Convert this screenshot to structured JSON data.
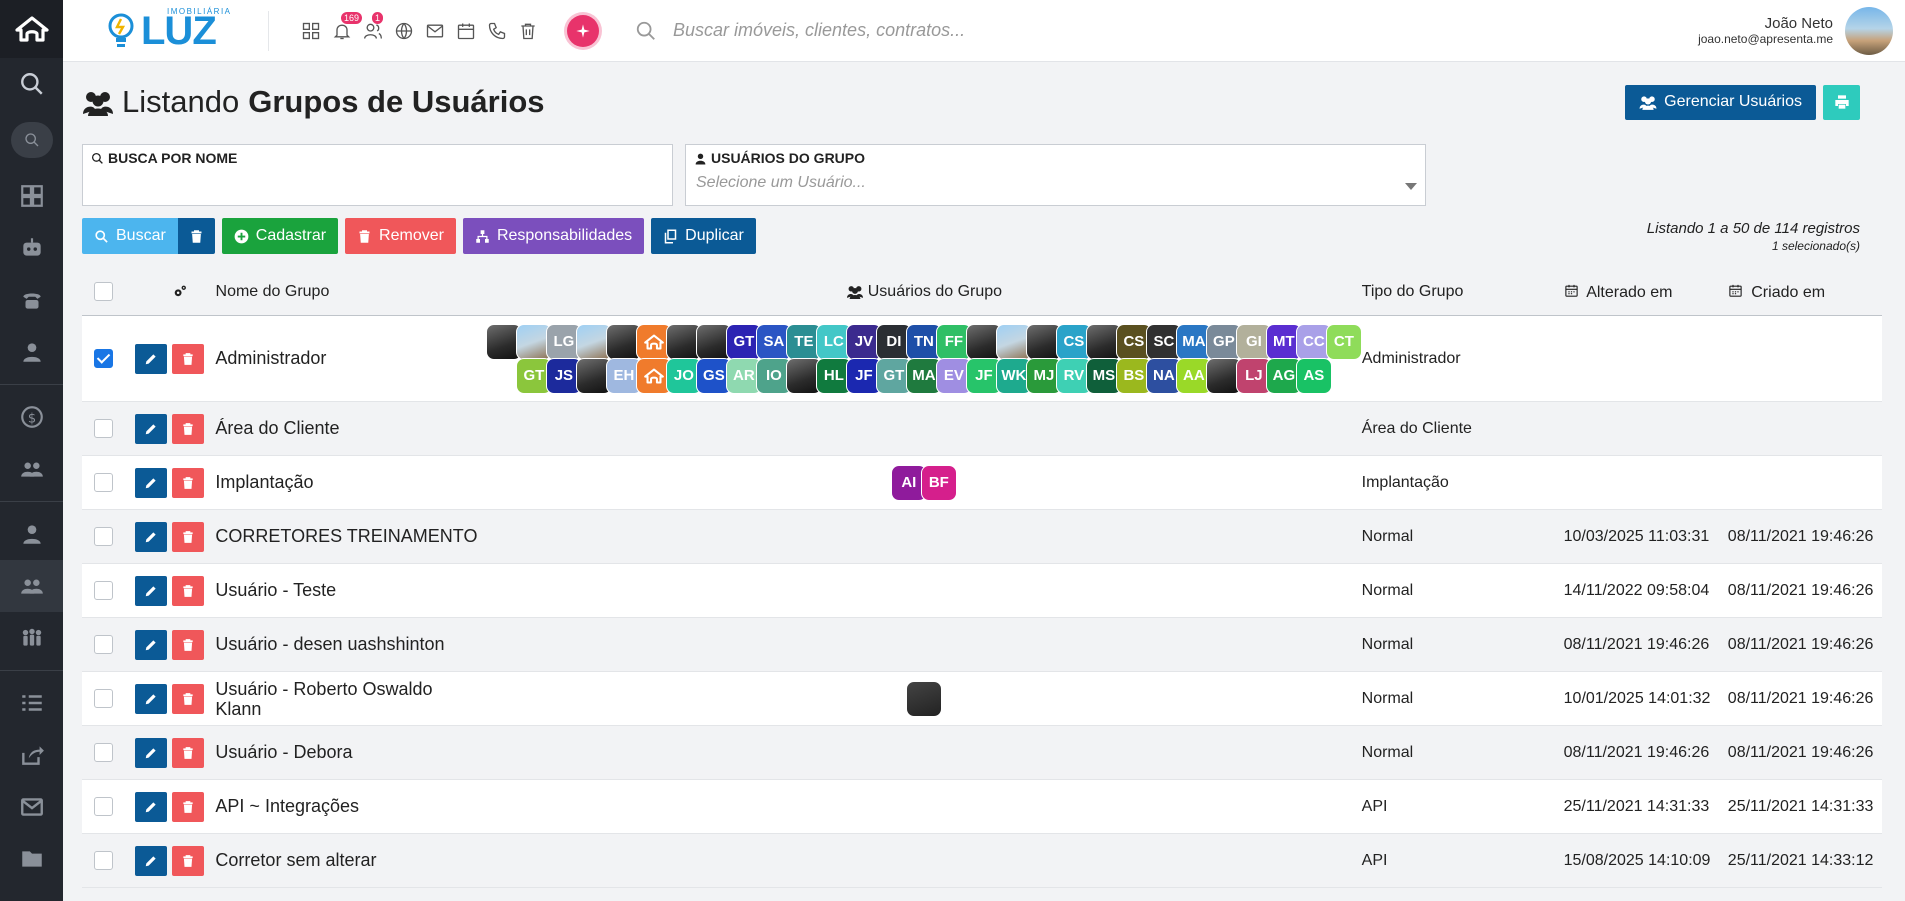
{
  "brand": {
    "small": "IMOBILIÁRIA",
    "big": "LUZ"
  },
  "topbar": {
    "search_placeholder": "Buscar imóveis, clientes, contratos...",
    "notifications_badge": "169",
    "users_badge": "1",
    "user_name": "João Neto",
    "user_email": "joao.neto@apresenta.me"
  },
  "page": {
    "title_prefix": "Listando",
    "title_bold": "Grupos de Usuários",
    "manage_label": "Gerenciar Usuários"
  },
  "filters": {
    "name_label": "BUSCA POR NOME",
    "name_value": "",
    "users_label": "USUÁRIOS DO GRUPO",
    "users_placeholder": "Selecione um Usuário..."
  },
  "actions": {
    "buscar": "Buscar",
    "cadastrar": "Cadastrar",
    "remover": "Remover",
    "responsabilidades": "Responsabilidades",
    "duplicar": "Duplicar"
  },
  "listing": {
    "summary": "Listando 1 a 50 de 114 registros",
    "selected": "1 selecionado(s)"
  },
  "table": {
    "headers": {
      "name": "Nome do Grupo",
      "users": "Usuários do Grupo",
      "type": "Tipo do Grupo",
      "altered": "Alterado em",
      "created": "Criado em"
    },
    "rows": [
      {
        "name": "Administrador",
        "type": "Administrador",
        "altered": "",
        "created": "",
        "checked": true
      },
      {
        "name": "Área do Cliente",
        "type": "Área do Cliente",
        "altered": "",
        "created": "",
        "checked": false
      },
      {
        "name": "Implantação",
        "type": "Implantação",
        "altered": "",
        "created": "",
        "checked": false
      },
      {
        "name": "CORRETORES TREINAMENTO",
        "type": "Normal",
        "altered": "10/03/2025 11:03:31",
        "created": "08/11/2021 19:46:26",
        "checked": false
      },
      {
        "name": "Usuário - Teste",
        "type": "Normal",
        "altered": "14/11/2022 09:58:04",
        "created": "08/11/2021 19:46:26",
        "checked": false
      },
      {
        "name": "Usuário - desen uashshinton",
        "type": "Normal",
        "altered": "08/11/2021 19:46:26",
        "created": "08/11/2021 19:46:26",
        "checked": false
      },
      {
        "name": "Usuário - Roberto Oswaldo Klann",
        "type": "Normal",
        "altered": "10/01/2025 14:01:32",
        "created": "08/11/2021 19:46:26",
        "checked": false
      },
      {
        "name": "Usuário - Debora",
        "type": "Normal",
        "altered": "08/11/2021 19:46:26",
        "created": "08/11/2021 19:46:26",
        "checked": false
      },
      {
        "name": "API ~ Integrações",
        "type": "API",
        "altered": "25/11/2021 14:31:33",
        "created": "25/11/2021 14:31:33",
        "checked": false
      },
      {
        "name": "Corretor sem alterar",
        "type": "API",
        "altered": "15/08/2025 14:10:09",
        "created": "25/11/2021 14:33:12",
        "checked": false
      }
    ],
    "admin_avatars_row1": [
      "photo",
      "photo2",
      "LG",
      "photo2",
      "photo",
      "logo",
      "photo",
      "photo",
      "GT",
      "SA",
      "TE",
      "LC",
      "JV",
      "DI",
      "TN",
      "FF",
      "photo",
      "photo2",
      "photo",
      "CS",
      "photo",
      "CS",
      "SC",
      "MA",
      "GP",
      "GI",
      "MT",
      "CC",
      "CT"
    ],
    "admin_avatars_row2": [
      "GT",
      "JS",
      "photo",
      "EH",
      "logo",
      "JO",
      "GS",
      "AR",
      "IO",
      "photo",
      "HL",
      "JF",
      "GT",
      "MA",
      "EV",
      "JF",
      "WK",
      "MJ",
      "RV",
      "MS",
      "BS",
      "NA",
      "AA",
      "photo",
      "LJ",
      "AG",
      "AS"
    ],
    "impl_avatars": [
      "AI",
      "BF"
    ],
    "colors_row1": [
      "",
      "",
      "#9aa3ab",
      "",
      "",
      "#f07b2c",
      "",
      "",
      "#2c23b3",
      "#2b55c4",
      "#2b8e93",
      "#43c7c7",
      "#3b2a8e",
      "#2b2e33",
      "#1e4fa8",
      "#2fbf66",
      "",
      "",
      "",
      "#2aa3c9",
      "",
      "#5a5020",
      "#313131",
      "#2a77c4",
      "#7a8a99",
      "#b2b09b",
      "#5a2ed1",
      "#a9a0e8",
      "#8fdc5a"
    ],
    "colors_row2": [
      "#8bc63c",
      "#1c2a9c",
      "",
      "#9fb8e0",
      "#2a77c4",
      "#1fc69a",
      "#1e52c9",
      "#8fd9b0",
      "#4ea38b",
      "",
      "#107a3e",
      "#1b28b0",
      "#5fa6a0",
      "#1f7a3e",
      "#9f8ee2",
      "#27c46a",
      "#1eaa8e",
      "#2a9a3a",
      "#3ed0b4",
      "#0f5f3a",
      "#9bb81e",
      "#2d4fa0",
      "#9ad928",
      "",
      "#c0436e",
      "#1ea84c",
      "#19c265"
    ],
    "impl_colors": [
      "#8f1b9c",
      "#d51f8c"
    ]
  },
  "colors": {
    "sidebar": "#23272e",
    "primary": "#0b5a96",
    "accent": "#e8336b"
  }
}
